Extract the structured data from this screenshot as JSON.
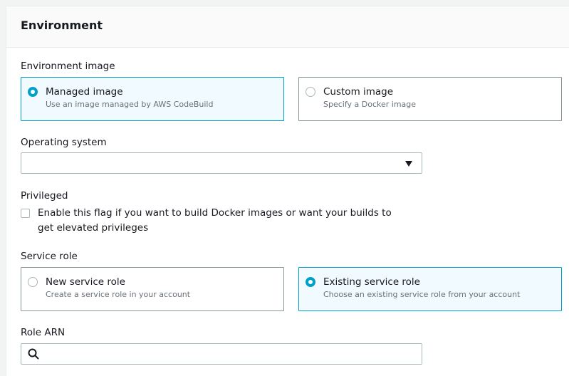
{
  "section": {
    "title": "Environment"
  },
  "environment_image": {
    "label": "Environment image",
    "options": [
      {
        "title": "Managed image",
        "description": "Use an image managed by AWS CodeBuild",
        "selected": true
      },
      {
        "title": "Custom image",
        "description": "Specify a Docker image",
        "selected": false
      }
    ]
  },
  "operating_system": {
    "label": "Operating system",
    "value": ""
  },
  "privileged": {
    "label": "Privileged",
    "checkbox_label": "Enable this flag if you want to build Docker images or want your builds to get elevated privileges",
    "checked": false
  },
  "service_role": {
    "label": "Service role",
    "options": [
      {
        "title": "New service role",
        "description": "Create a service role in your account",
        "selected": false
      },
      {
        "title": "Existing service role",
        "description": "Choose an existing service role from your account",
        "selected": true
      }
    ]
  },
  "role_arn": {
    "label": "Role ARN",
    "placeholder": "",
    "value": ""
  },
  "colors": {
    "accent": "#00a1c9",
    "selected_bg": "#f1faff",
    "border": "#879596"
  },
  "icons": {
    "search": "search-icon",
    "dropdown": "caret-down-icon"
  }
}
